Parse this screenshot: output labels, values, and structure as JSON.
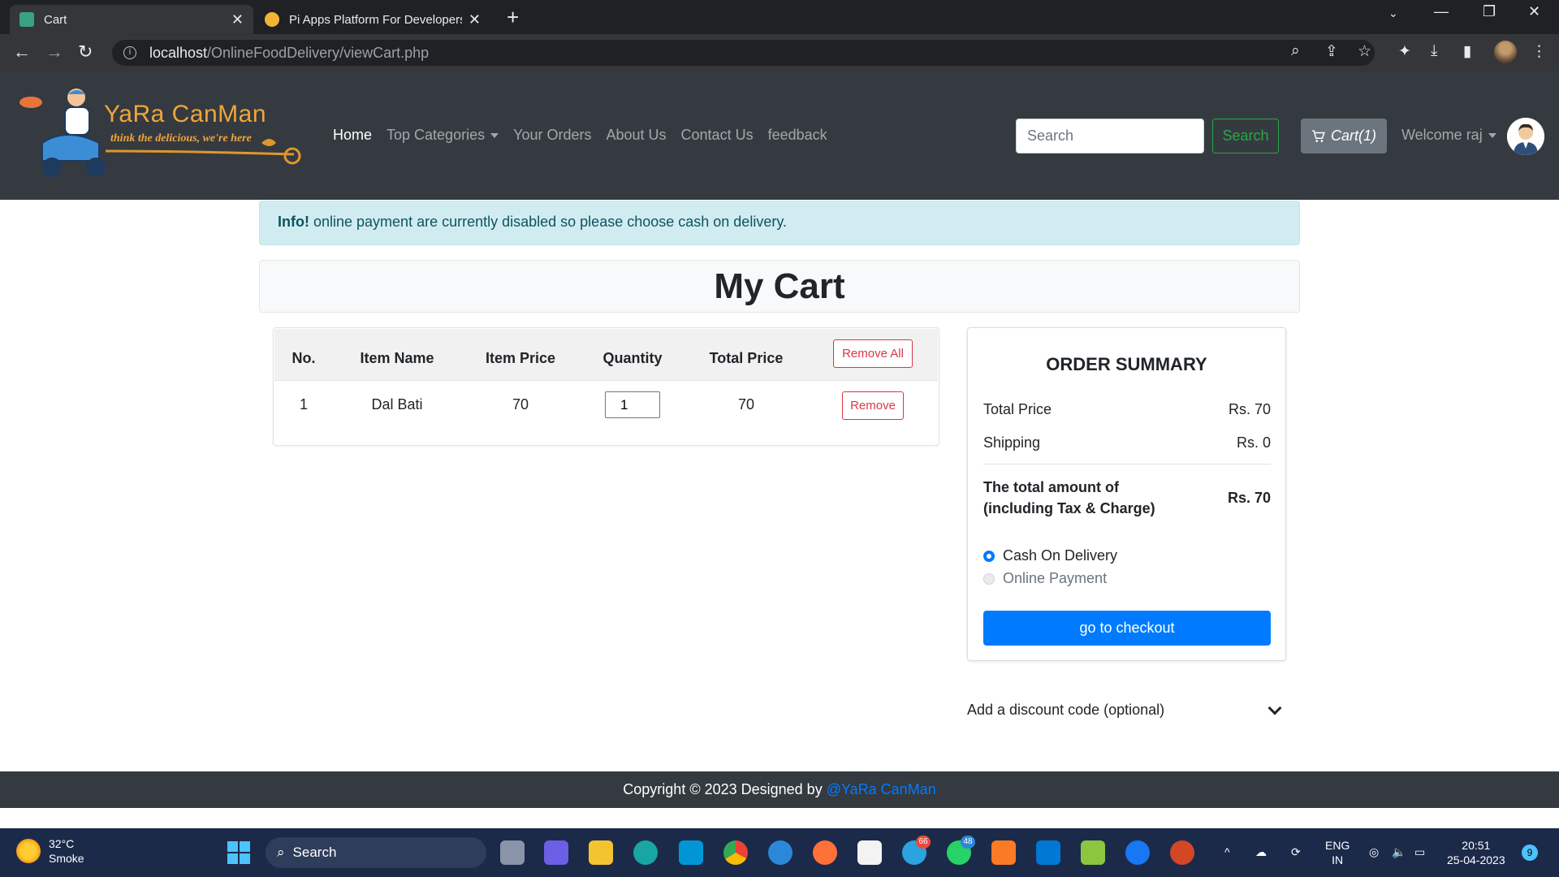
{
  "browser": {
    "tabs": [
      {
        "title": "Cart",
        "active": true
      },
      {
        "title": "Pi Apps Platform For Developers",
        "active": false
      }
    ],
    "url_host": "localhost",
    "url_path": "/OnlineFoodDelivery/viewCart.php"
  },
  "site": {
    "brand_name": "YaRa CanMan",
    "tagline": "think the delicious, we're here",
    "menu": [
      "Home",
      "Top Categories",
      "Your Orders",
      "About Us",
      "Contact Us",
      "feedback"
    ],
    "search_placeholder": "Search",
    "search_button": "Search",
    "cart_label": "Cart(1)",
    "welcome": "Welcome raj"
  },
  "alert": {
    "strong": "Info!",
    "message": " online payment are currently disabled so please choose cash on delivery."
  },
  "page_title": "My Cart",
  "cart_table": {
    "headers": [
      "No.",
      "Item Name",
      "Item Price",
      "Quantity",
      "Total Price"
    ],
    "remove_all": "Remove All",
    "rows": [
      {
        "no": "1",
        "name": "Dal Bati",
        "price": "70",
        "quantity": "1",
        "total": "70",
        "remove": "Remove"
      }
    ]
  },
  "summary": {
    "title": "ORDER SUMMARY",
    "total_label": "Total Price",
    "total_value": "Rs. 70",
    "shipping_label": "Shipping",
    "shipping_value": "Rs. 0",
    "grand_label_1": "The total amount of",
    "grand_label_2": "(including Tax & Charge)",
    "grand_value": "Rs. 70",
    "payment_options": [
      {
        "label": "Cash On Delivery",
        "checked": true,
        "disabled": false
      },
      {
        "label": "Online Payment",
        "checked": false,
        "disabled": true
      }
    ],
    "checkout_button": "go to checkout"
  },
  "discount": {
    "label": "Add a discount code (optional)"
  },
  "footer": {
    "text": "Copyright © 2023 Designed by ",
    "link": "@YaRa CanMan"
  },
  "taskbar": {
    "temperature": "32°C",
    "weather": "Smoke",
    "search": "Search",
    "lang_1": "ENG",
    "lang_2": "IN",
    "time": "20:51",
    "date": "25-04-2023",
    "notifications": "9",
    "badge_telegram": "66",
    "badge_whatsapp": "48"
  },
  "colors": {
    "navbar": "#343a40",
    "primary": "#007bff",
    "success": "#28a745",
    "danger": "#dc3545",
    "info_bg": "#d1ecf1",
    "taskbar": "#1c2a4a"
  }
}
